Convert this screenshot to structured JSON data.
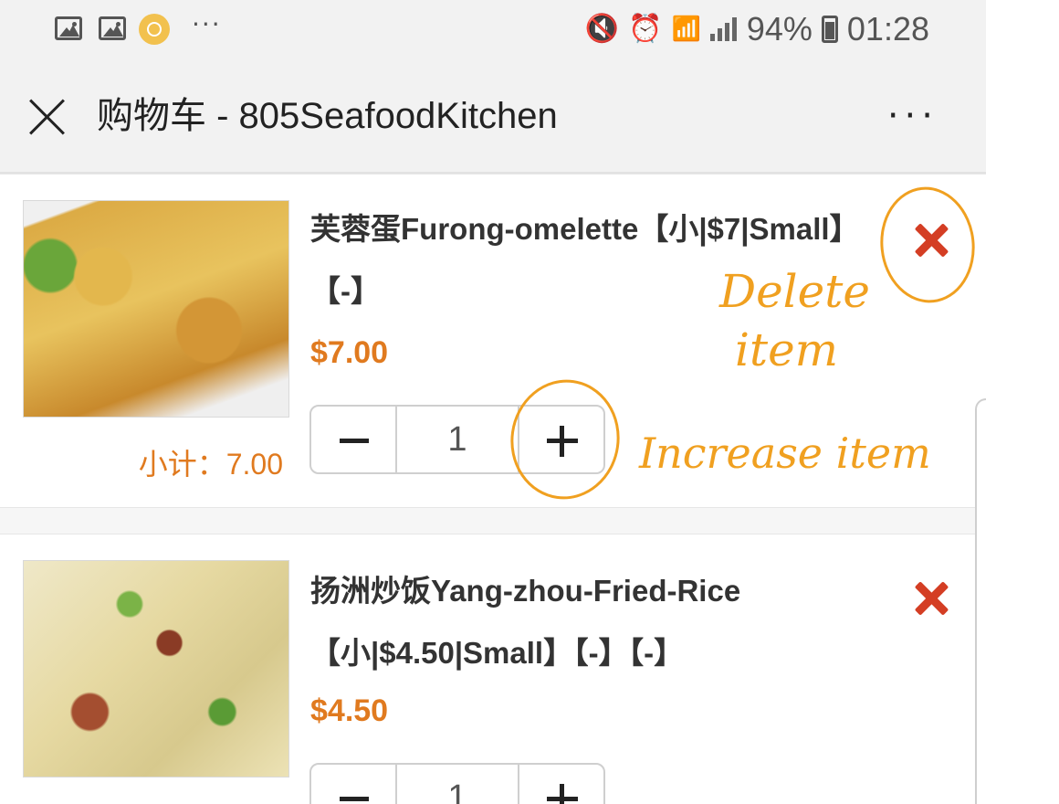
{
  "status_bar": {
    "battery": "94%",
    "time": "01:28",
    "more": "···",
    "icons": [
      "gallery-icon",
      "gallery-icon",
      "clock-app-icon",
      "mute-vibrate-icon",
      "alarm-icon",
      "wifi-icon",
      "signal-icon",
      "battery-icon"
    ]
  },
  "header": {
    "title": "购物车 - 805SeafoodKitchen",
    "more": "···"
  },
  "cart": {
    "items": [
      {
        "name": "芙蓉蛋Furong-omelette【小|$7|Small】【-】",
        "price": "$7.00",
        "quantity": "1",
        "subtotal": "小计：7.00"
      },
      {
        "name": "扬洲炒饭Yang-zhou-Fried-Rice【小|$4.50|Small】【-】【-】",
        "price": "$4.50",
        "quantity": "1",
        "subtotal": ""
      }
    ]
  },
  "annotations": {
    "delete_line1": "Delete",
    "delete_line2": "item",
    "increase": "Increase item",
    "color": "#f0a020"
  },
  "colors": {
    "accent": "#e07a1f",
    "delete": "#d43e24"
  }
}
